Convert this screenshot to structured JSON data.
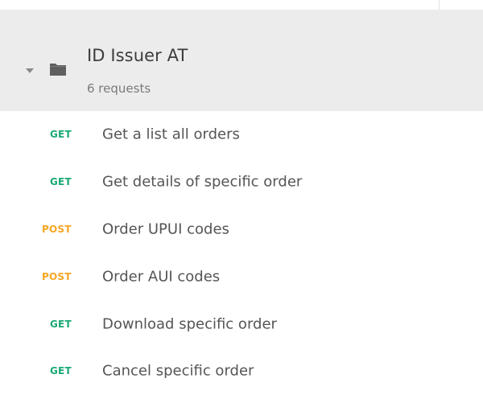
{
  "colors": {
    "get": "#19a974",
    "post": "#f5a623",
    "header_bg": "#ececec"
  },
  "collection": {
    "name": "ID Issuer AT",
    "count_label": "6 requests",
    "expanded": true,
    "icon": "folder-icon"
  },
  "requests": [
    {
      "method": "GET",
      "label": "Get a list all orders"
    },
    {
      "method": "GET",
      "label": "Get details of specific order"
    },
    {
      "method": "POST",
      "label": "Order UPUI codes"
    },
    {
      "method": "POST",
      "label": "Order AUI codes"
    },
    {
      "method": "GET",
      "label": "Download specific order"
    },
    {
      "method": "GET",
      "label": "Cancel specific order"
    }
  ]
}
